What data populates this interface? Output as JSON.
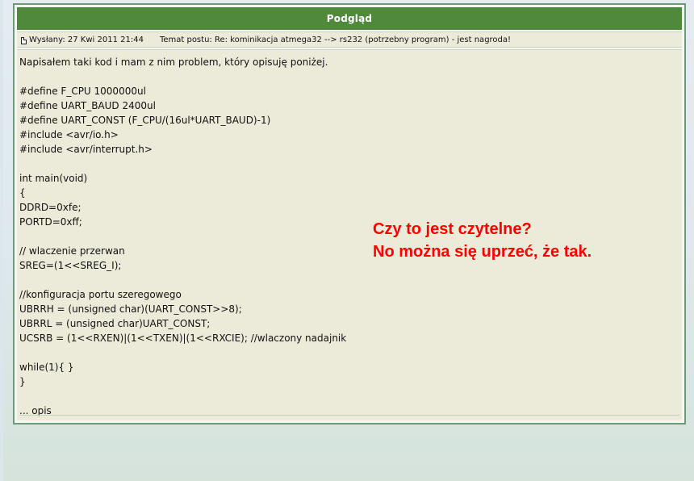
{
  "header": {
    "title": "Podgląd"
  },
  "meta": {
    "sent_label": "Wysłany: 27 Kwi 2011 21:44",
    "subject_label": "Temat postu: Re: kominikacja atmega32 --> rs232 (potrzebny program) - jest nagroda!"
  },
  "post": {
    "lines": [
      "Napisałem taki kod i mam z nim problem, który opisuję poniżej.",
      "",
      "#define F_CPU 1000000ul",
      "#define UART_BAUD 2400ul",
      "#define UART_CONST (F_CPU/(16ul*UART_BAUD)-1)",
      "#include <avr/io.h>",
      "#include <avr/interrupt.h>",
      "",
      "int main(void)",
      "{",
      "DDRD=0xfe;",
      "PORTD=0xff;",
      "",
      "// wlaczenie przerwan",
      "SREG=(1<<SREG_I);",
      "",
      "//konfiguracja portu szeregowego",
      "UBRRH = (unsigned char)(UART_CONST>>8);",
      "UBRRL = (unsigned char)UART_CONST;",
      "UCSRB = (1<<RXEN)|(1<<TXEN)|(1<<RXCIE); //wlaczony nadajnik",
      "",
      "while(1){ }",
      "}",
      "",
      "... opis"
    ]
  },
  "annotation": {
    "line1": "Czy to jest czytelne?",
    "line2": "No można się uprzeć, że tak."
  },
  "colors": {
    "header_bg": "#4f8a3c",
    "content_bg": "#ecebd9",
    "annotation": "#ff0000"
  }
}
